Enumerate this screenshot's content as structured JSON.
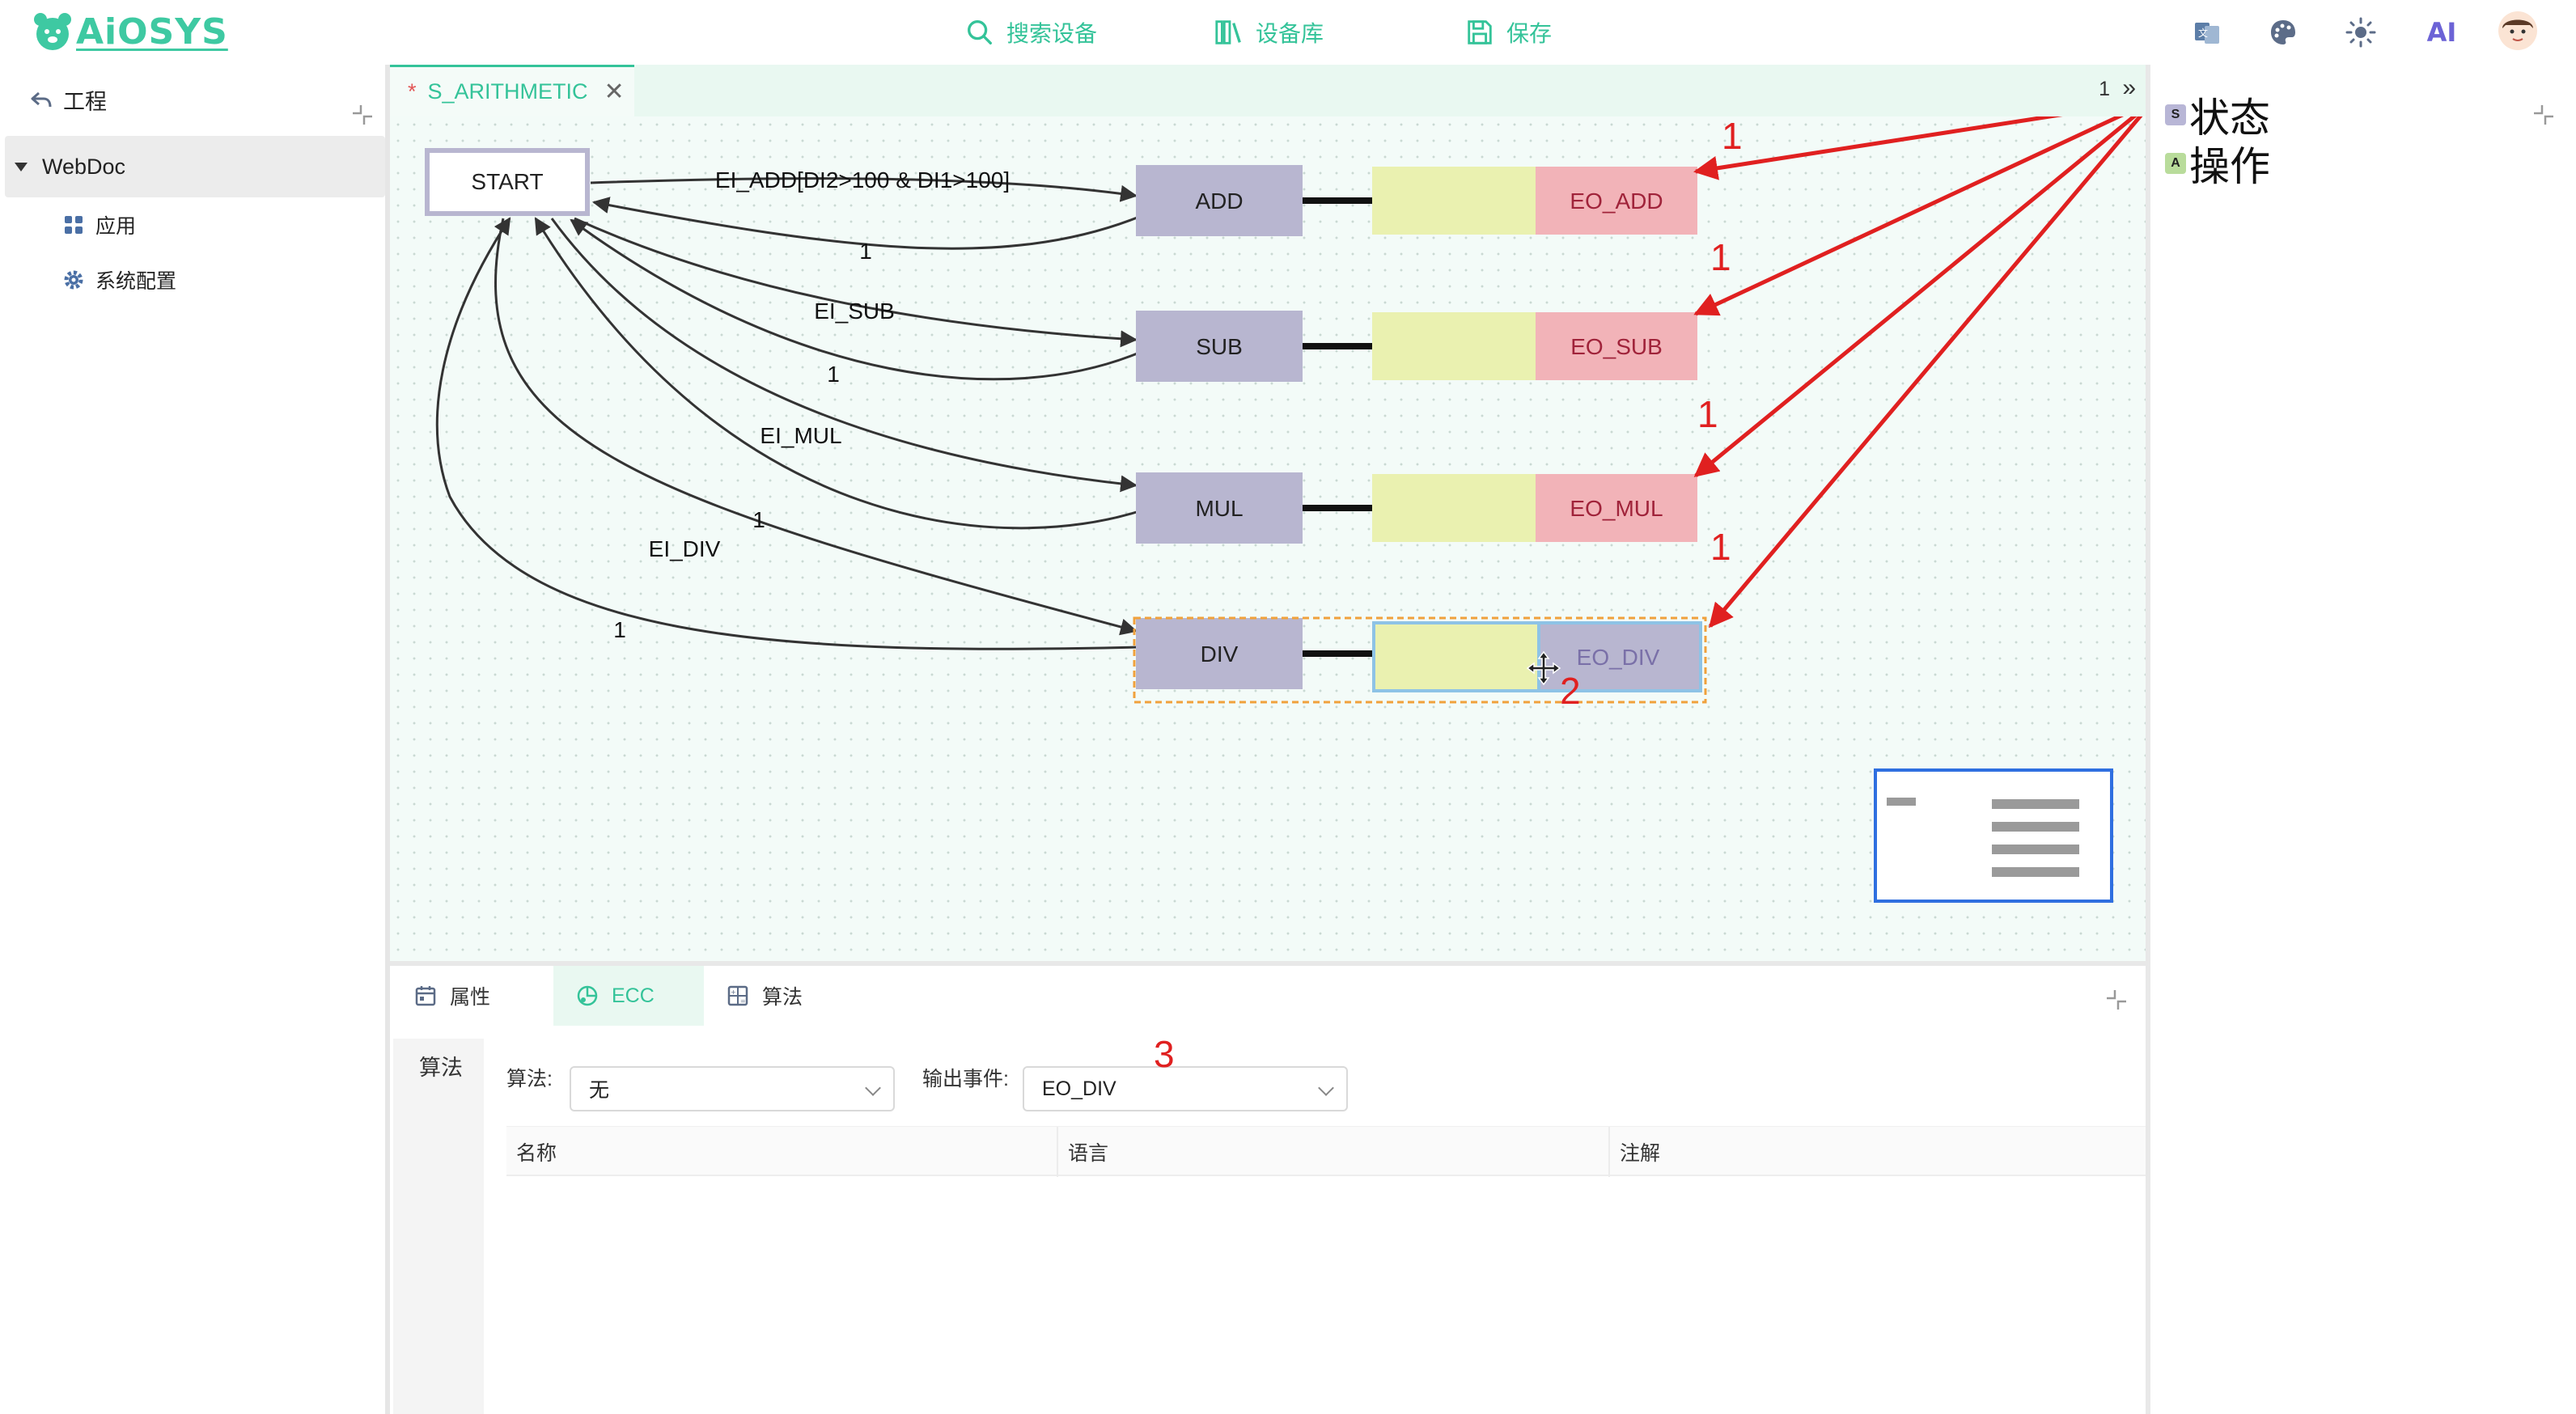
{
  "header": {
    "logo_text": "AiOSYS",
    "nav": [
      {
        "label": "搜索设备",
        "icon": "search-icon"
      },
      {
        "label": "设备库",
        "icon": "library-icon"
      },
      {
        "label": "保存",
        "icon": "save-icon"
      }
    ],
    "ai_label": "AI",
    "accent_color": "#34c399"
  },
  "sidebar": {
    "project_label": "工程",
    "root_label": "WebDoc",
    "items": [
      {
        "label": "应用",
        "icon": "apps-icon"
      },
      {
        "label": "系统配置",
        "icon": "gear-icon"
      }
    ]
  },
  "editor": {
    "tab": {
      "modified_marker": "*",
      "label": "S_ARITHMETIC"
    },
    "tab_count": "1",
    "tab_more": "»"
  },
  "diagram": {
    "start_label": "START",
    "states": [
      {
        "label": "ADD",
        "output": "EO_ADD"
      },
      {
        "label": "SUB",
        "output": "EO_SUB"
      },
      {
        "label": "MUL",
        "output": "EO_MUL"
      },
      {
        "label": "DIV",
        "output": "EO_DIV"
      }
    ],
    "transitions": [
      {
        "condition": "EI_ADD[DI2>100 & DI1>100]",
        "return": "1"
      },
      {
        "condition": "EI_SUB",
        "return": "1"
      },
      {
        "condition": "EI_MUL",
        "return": "1"
      },
      {
        "condition": "EI_DIV",
        "return": "1"
      }
    ],
    "annotations": {
      "arrow_counts": [
        "1",
        "1",
        "1",
        "1"
      ],
      "selected_marker": "2"
    },
    "colors": {
      "state": "#b8b6d0",
      "algo": "#eaf1b0",
      "output": "#f2b3b8",
      "annotation": "#e02020",
      "selection": "#f0a13c"
    }
  },
  "right_panel": {
    "items": [
      {
        "label": "状态",
        "badge": "S",
        "badge_color": "#b8b6d6"
      },
      {
        "label": "操作",
        "badge": "A",
        "badge_color": "#b9dc9b"
      }
    ]
  },
  "bottom_panel": {
    "tabs": [
      {
        "label": "属性",
        "icon": "calendar-icon"
      },
      {
        "label": "ECC",
        "icon": "ecc-icon"
      },
      {
        "label": "算法",
        "icon": "algorithm-icon"
      }
    ],
    "side_tab": "算法",
    "algorithm_label": "算法:",
    "algorithm_value": "无",
    "output_event_label": "输出事件:",
    "output_event_value": "EO_DIV",
    "marker": "3",
    "columns": [
      "名称",
      "语言",
      "注解"
    ]
  }
}
